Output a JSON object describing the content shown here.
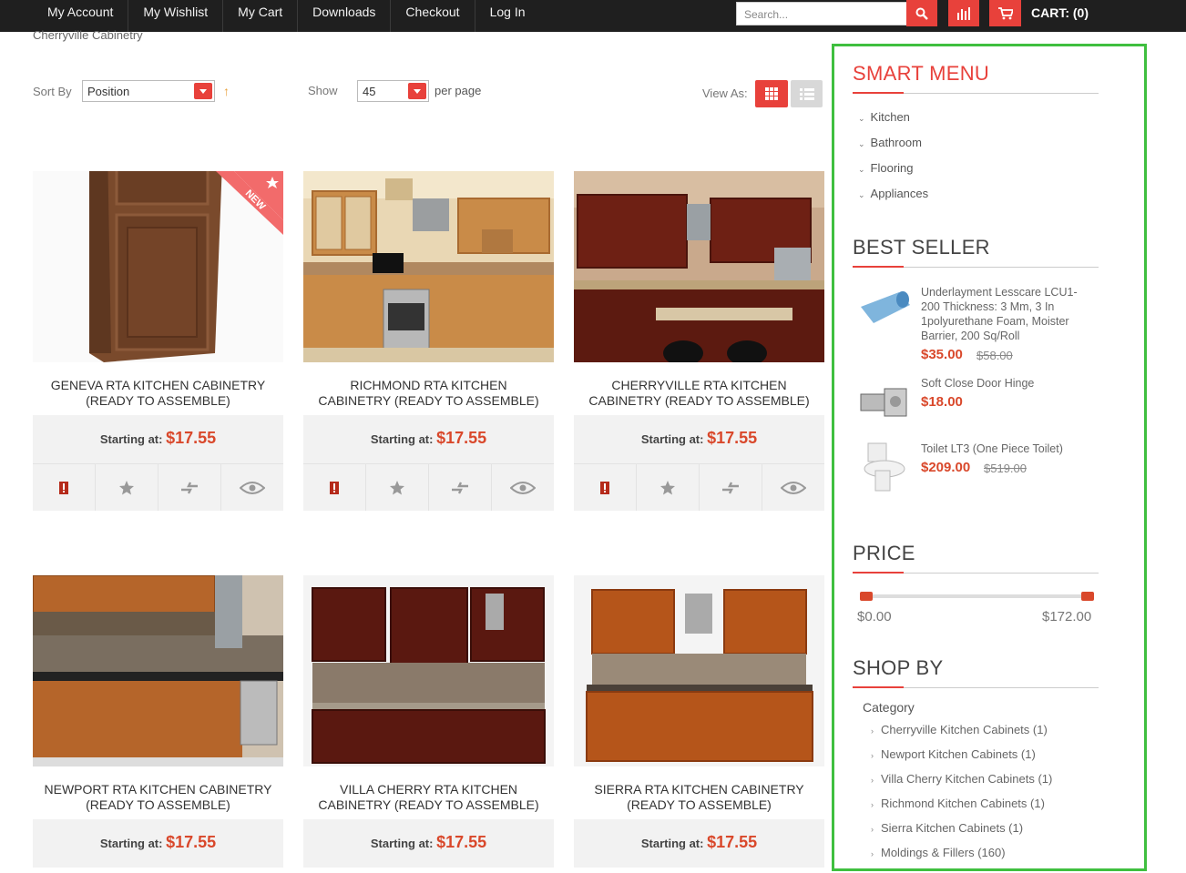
{
  "topnav": {
    "items": [
      "My Account",
      "My Wishlist",
      "My Cart",
      "Downloads",
      "Checkout",
      "Log In"
    ],
    "search_placeholder": "Search...",
    "cart_label": "CART: (0)"
  },
  "breadcrumb": "Cherryville Cabinetry",
  "toolbar": {
    "sort_label": "Sort By",
    "sort_value": "Position",
    "show_label": "Show",
    "show_value": "45",
    "per_page": "per page",
    "view_as": "View As:"
  },
  "products": [
    {
      "name": "Geneva RTA Kitchen Cabinetry (Ready To Assemble)",
      "starting": "Starting at:",
      "price": "$17.55",
      "badge": "NEW"
    },
    {
      "name": "Richmond RTA Kitchen Cabinetry (Ready To Assemble)",
      "starting": "Starting at:",
      "price": "$17.55"
    },
    {
      "name": "Cherryville RTA Kitchen Cabinetry (Ready To Assemble)",
      "starting": "Starting at:",
      "price": "$17.55"
    },
    {
      "name": "Newport RTA Kitchen Cabinetry (Ready To Assemble)",
      "starting": "Starting at:",
      "price": "$17.55"
    },
    {
      "name": "Villa Cherry RTA Kitchen Cabinetry (Ready To Assemble)",
      "starting": "Starting at:",
      "price": "$17.55"
    },
    {
      "name": "Sierra RTA Kitchen Cabinetry (Ready To Assemble)",
      "starting": "Starting at:",
      "price": "$17.55"
    }
  ],
  "sidebar": {
    "smart_menu_title": "SMART MENU",
    "smart_menu": [
      "Kitchen",
      "Bathroom",
      "Flooring",
      "Appliances"
    ],
    "best_seller_title": "BEST SELLER",
    "best_sellers": [
      {
        "name": "Underlayment Lesscare LCU1-200 Thickness: 3 Mm, 3 In 1polyurethane Foam, Moister Barrier, 200 Sq/Roll",
        "price": "$35.00",
        "old_price": "$58.00"
      },
      {
        "name": "Soft Close Door Hinge",
        "price": "$18.00",
        "old_price": ""
      },
      {
        "name": "Toilet LT3 (One Piece Toilet)",
        "price": "$209.00",
        "old_price": "$519.00"
      }
    ],
    "price_title": "PRICE",
    "price_min": "$0.00",
    "price_max": "$172.00",
    "shop_by_title": "SHOP BY",
    "category_label": "Category",
    "categories": [
      "Cherryville Kitchen Cabinets (1)",
      "Newport Kitchen Cabinets (1)",
      "Villa Cherry Kitchen Cabinets (1)",
      "Richmond Kitchen Cabinets (1)",
      "Sierra Kitchen Cabinets (1)",
      "Moldings & Fillers (160)"
    ]
  },
  "colors": {
    "accent": "#e8413b",
    "price": "#d9482b",
    "highlight": "#3fbf3f"
  }
}
